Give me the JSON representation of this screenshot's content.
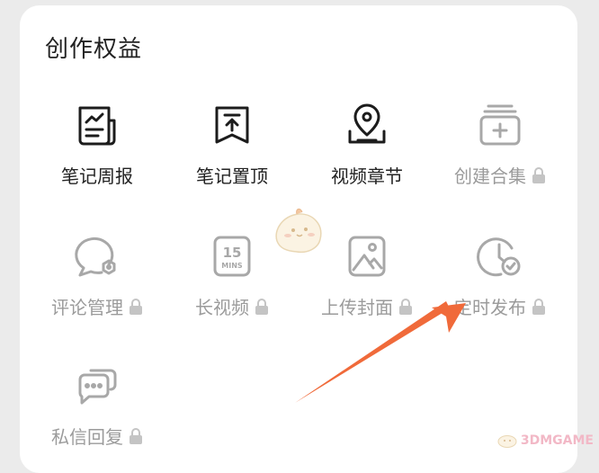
{
  "section": {
    "title": "创作权益"
  },
  "items": [
    {
      "label": "笔记周报",
      "icon": "report-icon",
      "locked": false
    },
    {
      "label": "笔记置顶",
      "icon": "pin-top-icon",
      "locked": false
    },
    {
      "label": "视频章节",
      "icon": "video-chapter-icon",
      "locked": false
    },
    {
      "label": "创建合集",
      "icon": "add-collection-icon",
      "locked": true
    },
    {
      "label": "评论管理",
      "icon": "comment-manage-icon",
      "locked": true
    },
    {
      "label": "长视频",
      "icon": "long-video-icon",
      "locked": true
    },
    {
      "label": "上传封面",
      "icon": "upload-cover-icon",
      "locked": true
    },
    {
      "label": "定时发布",
      "icon": "schedule-publish-icon",
      "locked": true
    },
    {
      "label": "私信回复",
      "icon": "message-reply-icon",
      "locked": true
    }
  ],
  "long_video_badge": {
    "top": "15",
    "bottom": "MINS"
  },
  "watermark": {
    "text": "3DMGAME"
  },
  "colors": {
    "enabled_text": "#222222",
    "disabled_text": "#9b9b9b",
    "arrow": "#f06a3a",
    "background": "#ebebeb"
  }
}
